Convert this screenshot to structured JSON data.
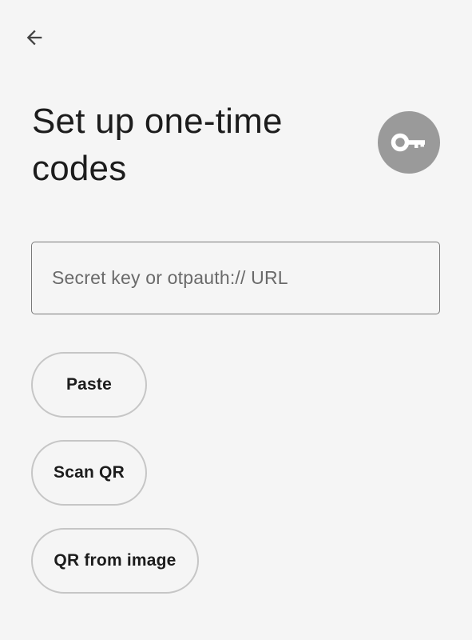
{
  "header": {
    "back_icon": "arrow-left-icon"
  },
  "title": {
    "text": "Set up one-time codes",
    "avatar_icon": "key-icon",
    "avatar_color": "#9a9a9a"
  },
  "secret_input": {
    "value": "",
    "placeholder": "Secret key or otpauth:// URL"
  },
  "actions": {
    "paste_label": "Paste",
    "scan_label": "Scan QR",
    "qr_image_label": "QR from image"
  }
}
